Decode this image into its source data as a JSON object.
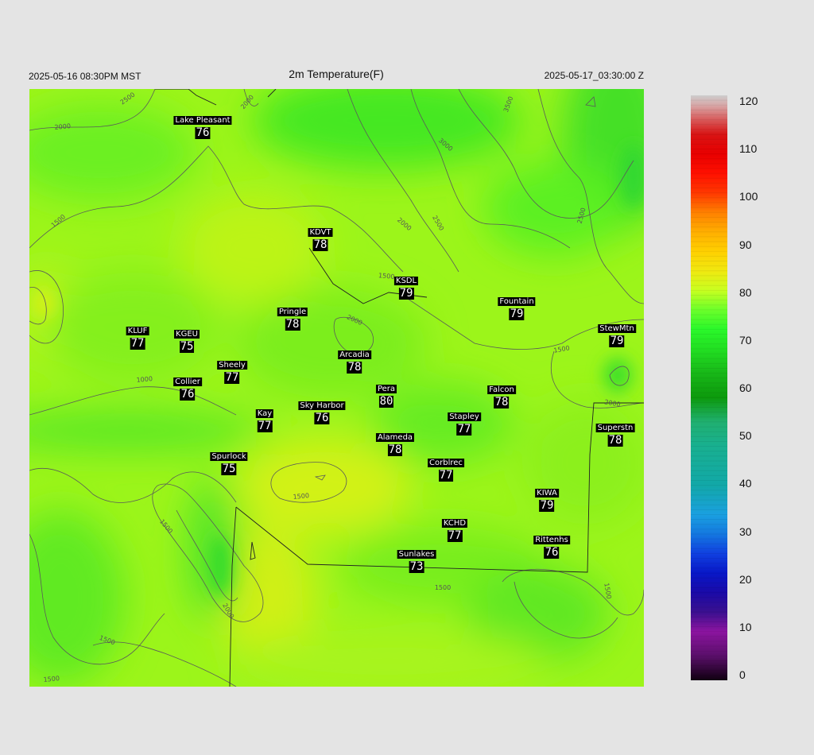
{
  "header": {
    "left": "2025-05-16 08:30PM MST",
    "title": "2m Temperature(F)",
    "right": "2025-05-17_03:30:00 Z"
  },
  "colorbar": {
    "min": 0,
    "max": 120,
    "ticks": [
      "0",
      "10",
      "20",
      "30",
      "40",
      "50",
      "60",
      "70",
      "80",
      "90",
      "100",
      "110",
      "120"
    ],
    "stops": [
      [
        0,
        "#100010"
      ],
      [
        5,
        "#5a0f6a"
      ],
      [
        10,
        "#8c14a0"
      ],
      [
        14,
        "#3a1090"
      ],
      [
        18,
        "#1a0aa8"
      ],
      [
        22,
        "#0818c8"
      ],
      [
        26,
        "#1040e0"
      ],
      [
        30,
        "#1478e0"
      ],
      [
        34,
        "#1aa0e0"
      ],
      [
        40,
        "#12a8a8"
      ],
      [
        48,
        "#18b090"
      ],
      [
        53,
        "#20b070"
      ],
      [
        58,
        "#0c9a0c"
      ],
      [
        63,
        "#18b818"
      ],
      [
        68,
        "#22e022"
      ],
      [
        72,
        "#2af82a"
      ],
      [
        76,
        "#6cff2a"
      ],
      [
        80,
        "#c8ff20"
      ],
      [
        84,
        "#f0e810"
      ],
      [
        88,
        "#ffd000"
      ],
      [
        92,
        "#ffae00"
      ],
      [
        96,
        "#ff8000"
      ],
      [
        100,
        "#ff3800"
      ],
      [
        104,
        "#ff1000"
      ],
      [
        108,
        "#e80000"
      ],
      [
        112,
        "#d81414"
      ],
      [
        115,
        "#d85a5a"
      ],
      [
        118,
        "#d8a8a8"
      ],
      [
        120,
        "#cccccc"
      ]
    ]
  },
  "contours": {
    "labels": [
      "2000",
      "2500",
      "2000",
      "3500",
      "3000",
      "2500",
      "2000",
      "2500",
      "1500",
      "1500",
      "2000",
      "1500",
      "1500",
      "1000",
      "2000",
      "1500",
      "1500",
      "1500",
      "2000",
      "1500",
      "1500"
    ]
  },
  "stations": [
    {
      "name": "Lake Pleasant",
      "value": "76"
    },
    {
      "name": "KDVT",
      "value": "78"
    },
    {
      "name": "KSDL",
      "value": "79"
    },
    {
      "name": "Fountain",
      "value": "79"
    },
    {
      "name": "Pringle",
      "value": "78"
    },
    {
      "name": "StewMtn",
      "value": "79"
    },
    {
      "name": "KLUF",
      "value": "77"
    },
    {
      "name": "KGEU",
      "value": "75"
    },
    {
      "name": "Arcadia",
      "value": "78"
    },
    {
      "name": "Sheely",
      "value": "77"
    },
    {
      "name": "Collier",
      "value": "76"
    },
    {
      "name": "Pera",
      "value": "80"
    },
    {
      "name": "Falcon",
      "value": "78"
    },
    {
      "name": "Sky Harbor",
      "value": "76"
    },
    {
      "name": "Kay",
      "value": "77"
    },
    {
      "name": "Stapley",
      "value": "77"
    },
    {
      "name": "Superstn",
      "value": "78"
    },
    {
      "name": "Alameda",
      "value": "78"
    },
    {
      "name": "Spurlock",
      "value": "75"
    },
    {
      "name": "Corblrec",
      "value": "77"
    },
    {
      "name": "KIWA",
      "value": "79"
    },
    {
      "name": "KCHD",
      "value": "77"
    },
    {
      "name": "Rittenhs",
      "value": "76"
    },
    {
      "name": "Sunlakes",
      "value": "73"
    }
  ]
}
